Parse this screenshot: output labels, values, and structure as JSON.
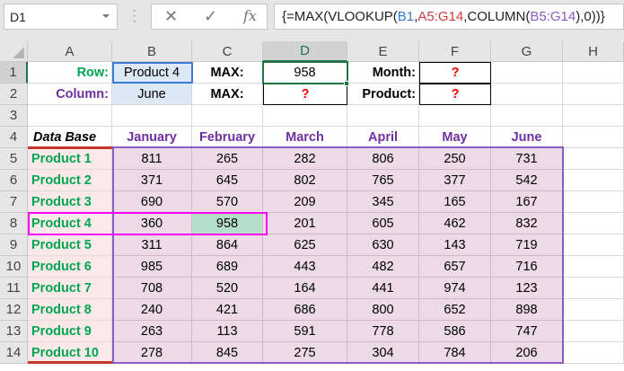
{
  "name_box": "D1",
  "formula_buttons": {
    "cancel": "✕",
    "enter": "✓",
    "fx": "fx"
  },
  "formula": [
    {
      "t": "{=MAX(VLOOKUP(",
      "c": "#222"
    },
    {
      "t": "B1",
      "c": "#3a7bd5"
    },
    {
      "t": ",",
      "c": "#222"
    },
    {
      "t": "A5:G14",
      "c": "#d23b3b"
    },
    {
      "t": ",COLUMN(",
      "c": "#222"
    },
    {
      "t": "B5:G14",
      "c": "#8a5cc4"
    },
    {
      "t": "),0))}",
      "c": "#222"
    }
  ],
  "columns": [
    "A",
    "B",
    "C",
    "D",
    "E",
    "F",
    "G",
    "H"
  ],
  "rows": [
    [
      "Row:",
      "Product 4",
      "MAX:",
      "958",
      "Month:",
      "?",
      "",
      ""
    ],
    [
      "Column:",
      "June",
      "MAX:",
      "?",
      "Product:",
      "?",
      "",
      ""
    ],
    [
      "",
      "",
      "",
      "",
      "",
      "",
      "",
      ""
    ],
    [
      "Data Base",
      "January",
      "February",
      "March",
      "April",
      "May",
      "June",
      ""
    ],
    [
      "Product 1",
      "811",
      "265",
      "282",
      "806",
      "250",
      "731",
      ""
    ],
    [
      "Product 2",
      "371",
      "645",
      "802",
      "765",
      "377",
      "542",
      ""
    ],
    [
      "Product 3",
      "690",
      "570",
      "209",
      "345",
      "165",
      "167",
      ""
    ],
    [
      "Product 4",
      "360",
      "958",
      "201",
      "605",
      "462",
      "832",
      ""
    ],
    [
      "Product 5",
      "311",
      "864",
      "625",
      "630",
      "143",
      "719",
      ""
    ],
    [
      "Product 6",
      "985",
      "689",
      "443",
      "482",
      "657",
      "716",
      ""
    ],
    [
      "Product 7",
      "708",
      "520",
      "164",
      "441",
      "974",
      "123",
      ""
    ],
    [
      "Product 8",
      "240",
      "421",
      "686",
      "800",
      "652",
      "898",
      ""
    ],
    [
      "Product 9",
      "263",
      "113",
      "591",
      "778",
      "586",
      "747",
      ""
    ],
    [
      "Product 10",
      "278",
      "845",
      "275",
      "304",
      "784",
      "206",
      ""
    ]
  ],
  "colors": {
    "green": "#00a550",
    "purple": "#7030a0",
    "red": "#ff0000",
    "selection": "#217346"
  }
}
